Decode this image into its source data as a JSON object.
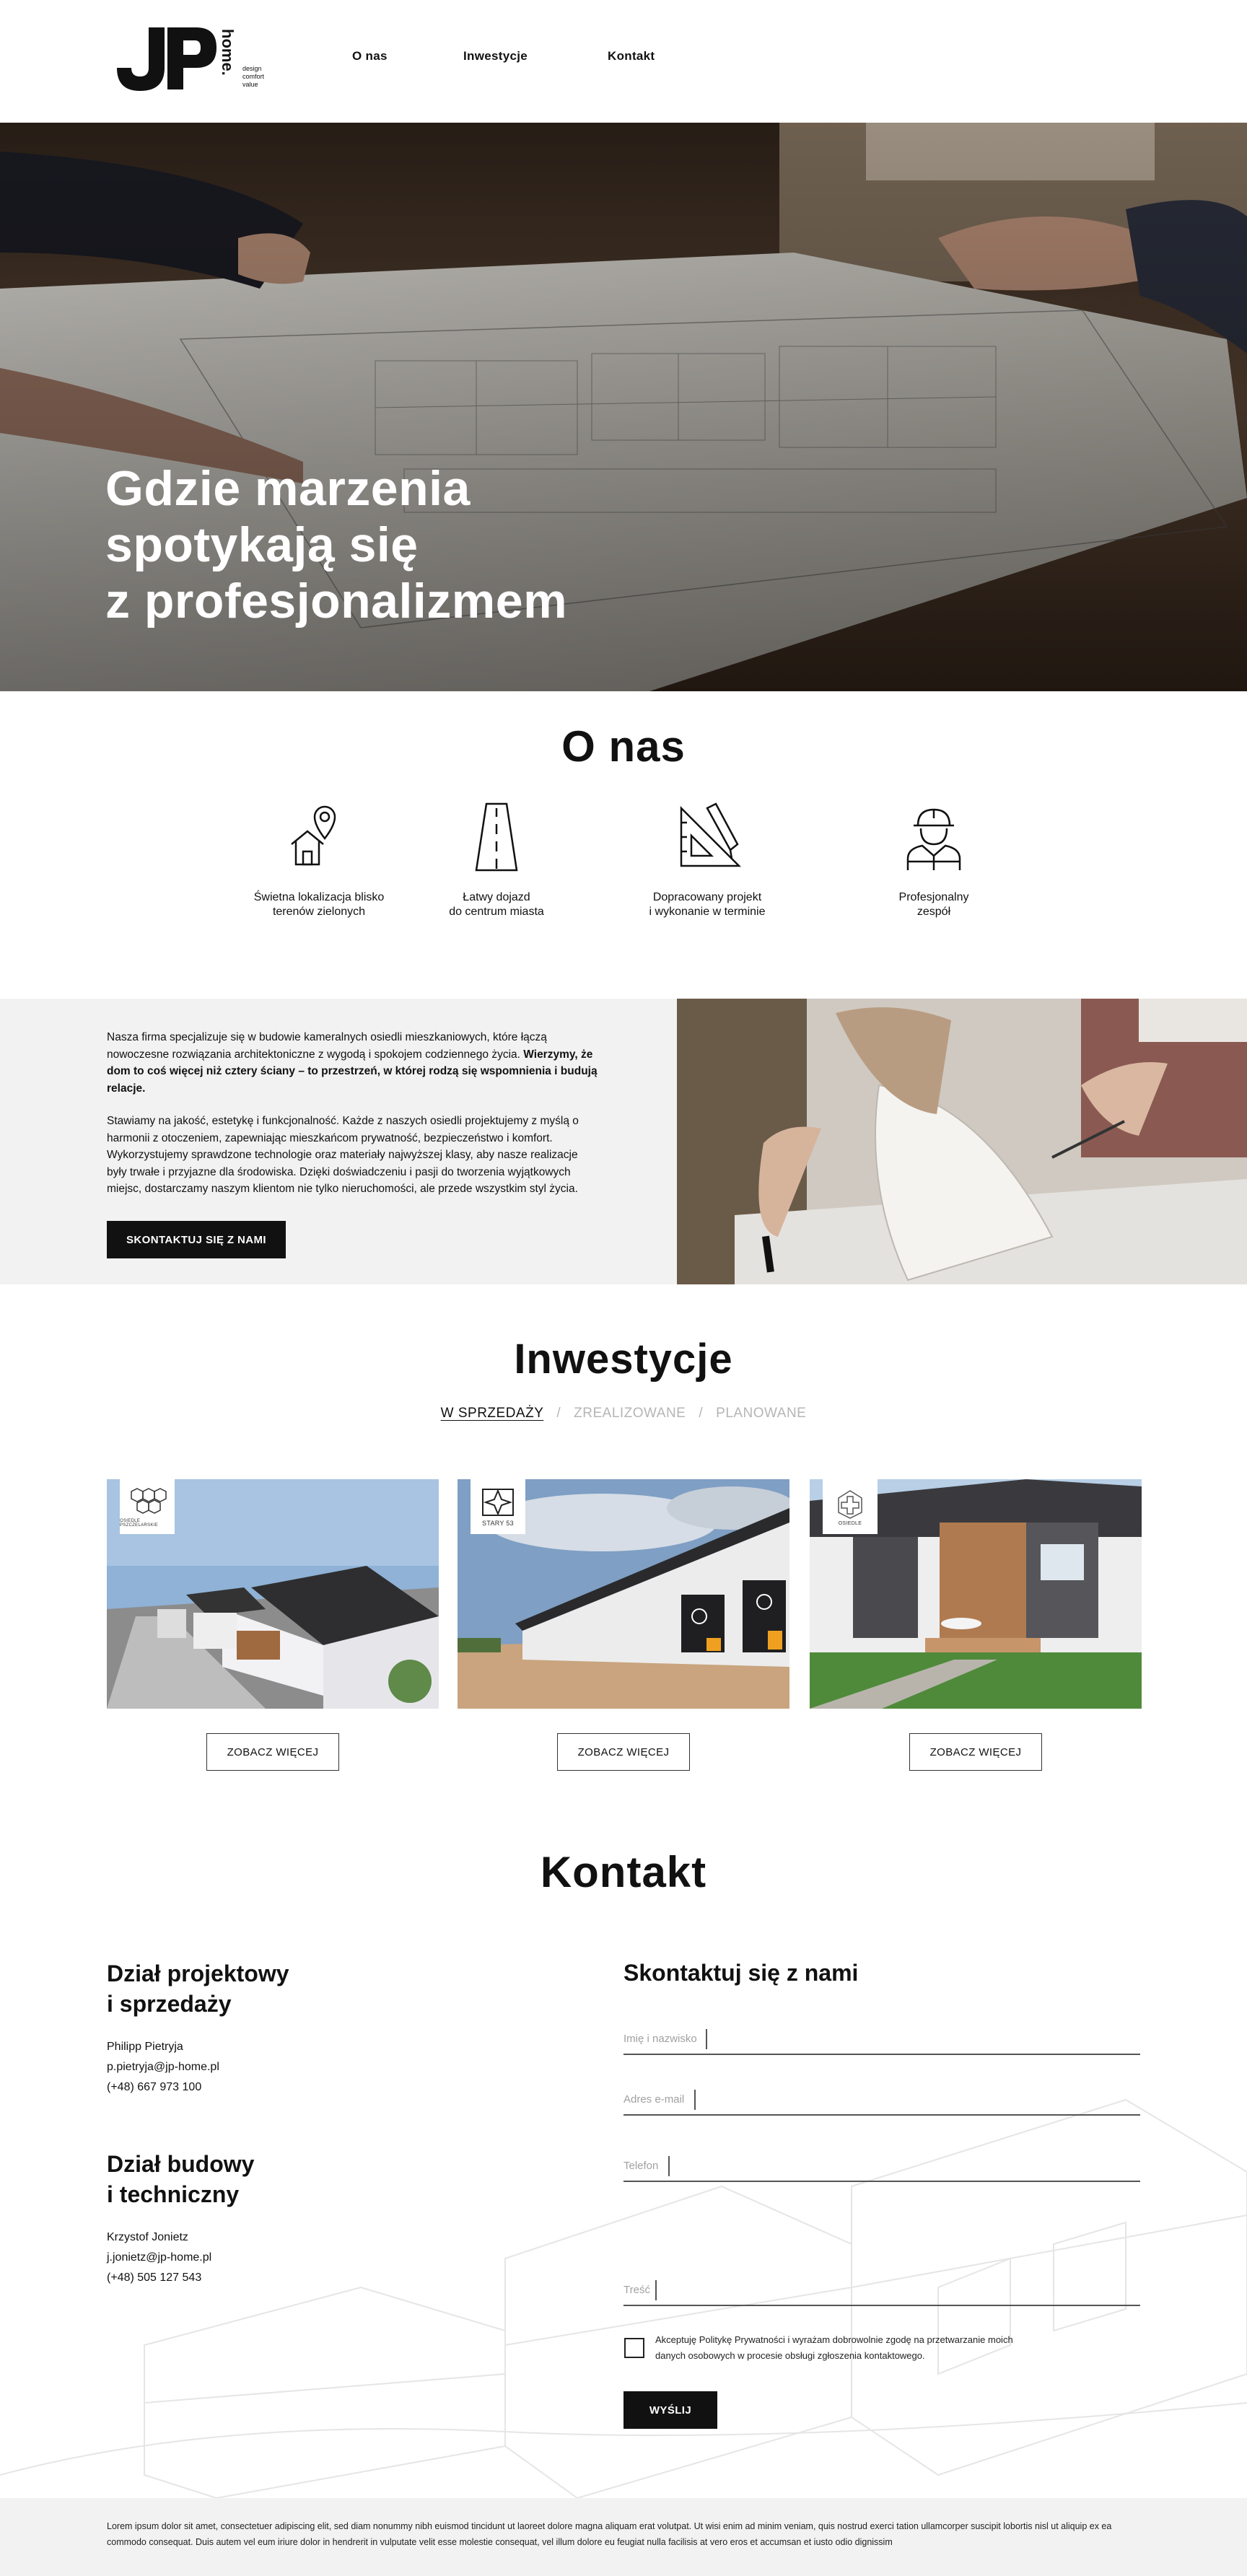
{
  "brand": {
    "logo_mark": "JP",
    "logo_word": "home.",
    "tagline": [
      "design",
      "comfort",
      "value"
    ]
  },
  "nav": {
    "items": [
      {
        "label": "O nas"
      },
      {
        "label": "Inwestycje"
      },
      {
        "label": "Kontakt"
      }
    ]
  },
  "hero": {
    "title_lines": [
      "Gdzie marzenia",
      "spotykają się",
      "z profesjonalizmem"
    ]
  },
  "about_section": {
    "title": "O nas",
    "features": [
      {
        "icon": "location-home-icon",
        "label": "Świetna lokalizacja blisko\nterenów zielonych"
      },
      {
        "icon": "road-icon",
        "label": "Łatwy dojazd\ndo centrum miasta"
      },
      {
        "icon": "set-square-pencil-icon",
        "label": "Dopracowany projekt\ni wykonanie w terminie"
      },
      {
        "icon": "construction-worker-icon",
        "label": "Profesjonalny\nzespół"
      }
    ],
    "paragraph1_plain": "Nasza firma specjalizuje się w budowie kameralnych osiedli mieszkaniowych, które łączą nowoczesne rozwiązania architektoniczne z wygodą i spokojem codziennego życia. ",
    "paragraph1_bold": "Wierzymy, że dom to coś więcej niż cztery ściany – to przestrzeń, w której rodzą się wspomnienia i budują relacje.",
    "paragraph2": "Stawiamy na jakość, estetykę i funkcjonalność. Każde z naszych osiedli projektujemy z myślą o harmonii z otoczeniem, zapewniając mieszkańcom prywatność, bezpieczeństwo i komfort. Wykorzystujemy sprawdzone technologie oraz materiały najwyższej klasy, aby nasze realizacje były trwałe i przyjazne dla środowiska. Dzięki doświadczeniu i pasji do tworzenia wyjątkowych miejsc, dostarczamy naszym klientom nie tylko nieruchomości, ale przede wszystkim styl życia.",
    "cta_label": "SKONTAKTUJ SIĘ Z NAMI"
  },
  "investments": {
    "title": "Inwestycje",
    "tabs": [
      {
        "label": "W SPRZEDAŻY",
        "active": true
      },
      {
        "label": "ZREALIZOWANE",
        "active": false
      },
      {
        "label": "PLANOWANE",
        "active": false
      }
    ],
    "tab_separator": "/",
    "cards": [
      {
        "badge_icon": "hexagons-icon",
        "badge_label": "OSIEDLE PSZCZELARSKIE",
        "button": "ZOBACZ WIĘCEJ"
      },
      {
        "badge_icon": "compass-star-icon",
        "badge_label": "STARY 53",
        "button": "ZOBACZ WIĘCEJ"
      },
      {
        "badge_icon": "cross-icon",
        "badge_label": "OSIEDLE",
        "button": "ZOBACZ WIĘCEJ"
      }
    ]
  },
  "contact": {
    "title": "Kontakt",
    "departments": [
      {
        "heading": "Dział projektowy\ni sprzedaży",
        "name": "Philipp Pietryja",
        "email": "p.pietryja@jp-home.pl",
        "phone": "(+48) 667 973 100"
      },
      {
        "heading": "Dział budowy\ni techniczny",
        "name": "Krzystof Jonietz",
        "email": "j.jonietz@jp-home.pl",
        "phone": "(+48) 505 127 543"
      }
    ],
    "form": {
      "title": "Skontaktuj się  z nami",
      "fields": [
        {
          "label": "Imię i nazwisko",
          "value": ""
        },
        {
          "label": "Adres e-mail",
          "value": ""
        },
        {
          "label": "Telefon",
          "value": ""
        },
        {
          "label": "Treść",
          "value": ""
        }
      ],
      "consent": "Akceptuję Politykę Prywatności i wyrażam dobrowolnie zgodę na przetwarzanie moich danych osobowych w procesie obsługi zgłoszenia kontaktowego.",
      "consent_checked": false,
      "submit": "WYŚLIJ"
    }
  },
  "footer": {
    "text": "Lorem ipsum dolor sit amet, consectetuer adipiscing elit, sed diam nonummy nibh euismod tincidunt ut laoreet dolore magna aliquam erat volutpat. Ut wisi enim ad minim veniam, quis nostrud exerci tation ullamcorper suscipit lobortis nisl ut aliquip ex ea commodo consequat. Duis autem vel eum iriure dolor in hendrerit in vulputate velit esse molestie consequat, vel illum dolore eu feugiat nulla facilisis at vero eros et accumsan et iusto odio dignissim"
  },
  "colors": {
    "dark": "#111111",
    "light_bg": "#f2f2f2",
    "muted_text": "#a0a0a0",
    "field_line": "#555555"
  }
}
